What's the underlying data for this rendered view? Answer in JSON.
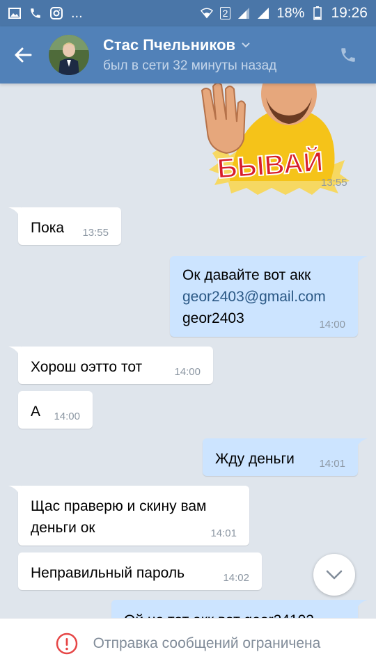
{
  "status_bar": {
    "battery": "18%",
    "time": "19:26",
    "sim_slot": "2",
    "more": "..."
  },
  "header": {
    "name": "Стас Пчельников",
    "status": "был в сети 32 минуты назад"
  },
  "sticker": {
    "text": "БЫВАЙ",
    "time": "13:55"
  },
  "messages": [
    {
      "direction": "in",
      "text": "Пока",
      "time": "13:55"
    },
    {
      "direction": "out",
      "lines": [
        "Ок давайте вот акк"
      ],
      "link": "geor2403@gmail.com",
      "line3": "geor2403",
      "time": "14:00"
    },
    {
      "direction": "in",
      "text": "Хорош оэтто тот",
      "time": "14:00"
    },
    {
      "direction": "in",
      "text": "А",
      "time": "14:00"
    },
    {
      "direction": "out",
      "text": "Жду деньги",
      "time": "14:01"
    },
    {
      "direction": "in",
      "line1": "Щас праверю и скину вам",
      "line2": "деньги ок",
      "time": "14:01"
    },
    {
      "direction": "in",
      "text": "Неправильный пароль",
      "time": "14:02"
    },
    {
      "direction": "out",
      "text": "Ой не тот акк вот geor24102",
      "time": ""
    }
  ],
  "footer": {
    "text": "Отправка сообщений ограничена"
  },
  "colors": {
    "header": "#5181b8",
    "status_bar": "#4a76a8",
    "background": "#dfe5ec",
    "outgoing": "#cce4ff",
    "incoming": "#ffffff",
    "alert": "#e64646"
  }
}
